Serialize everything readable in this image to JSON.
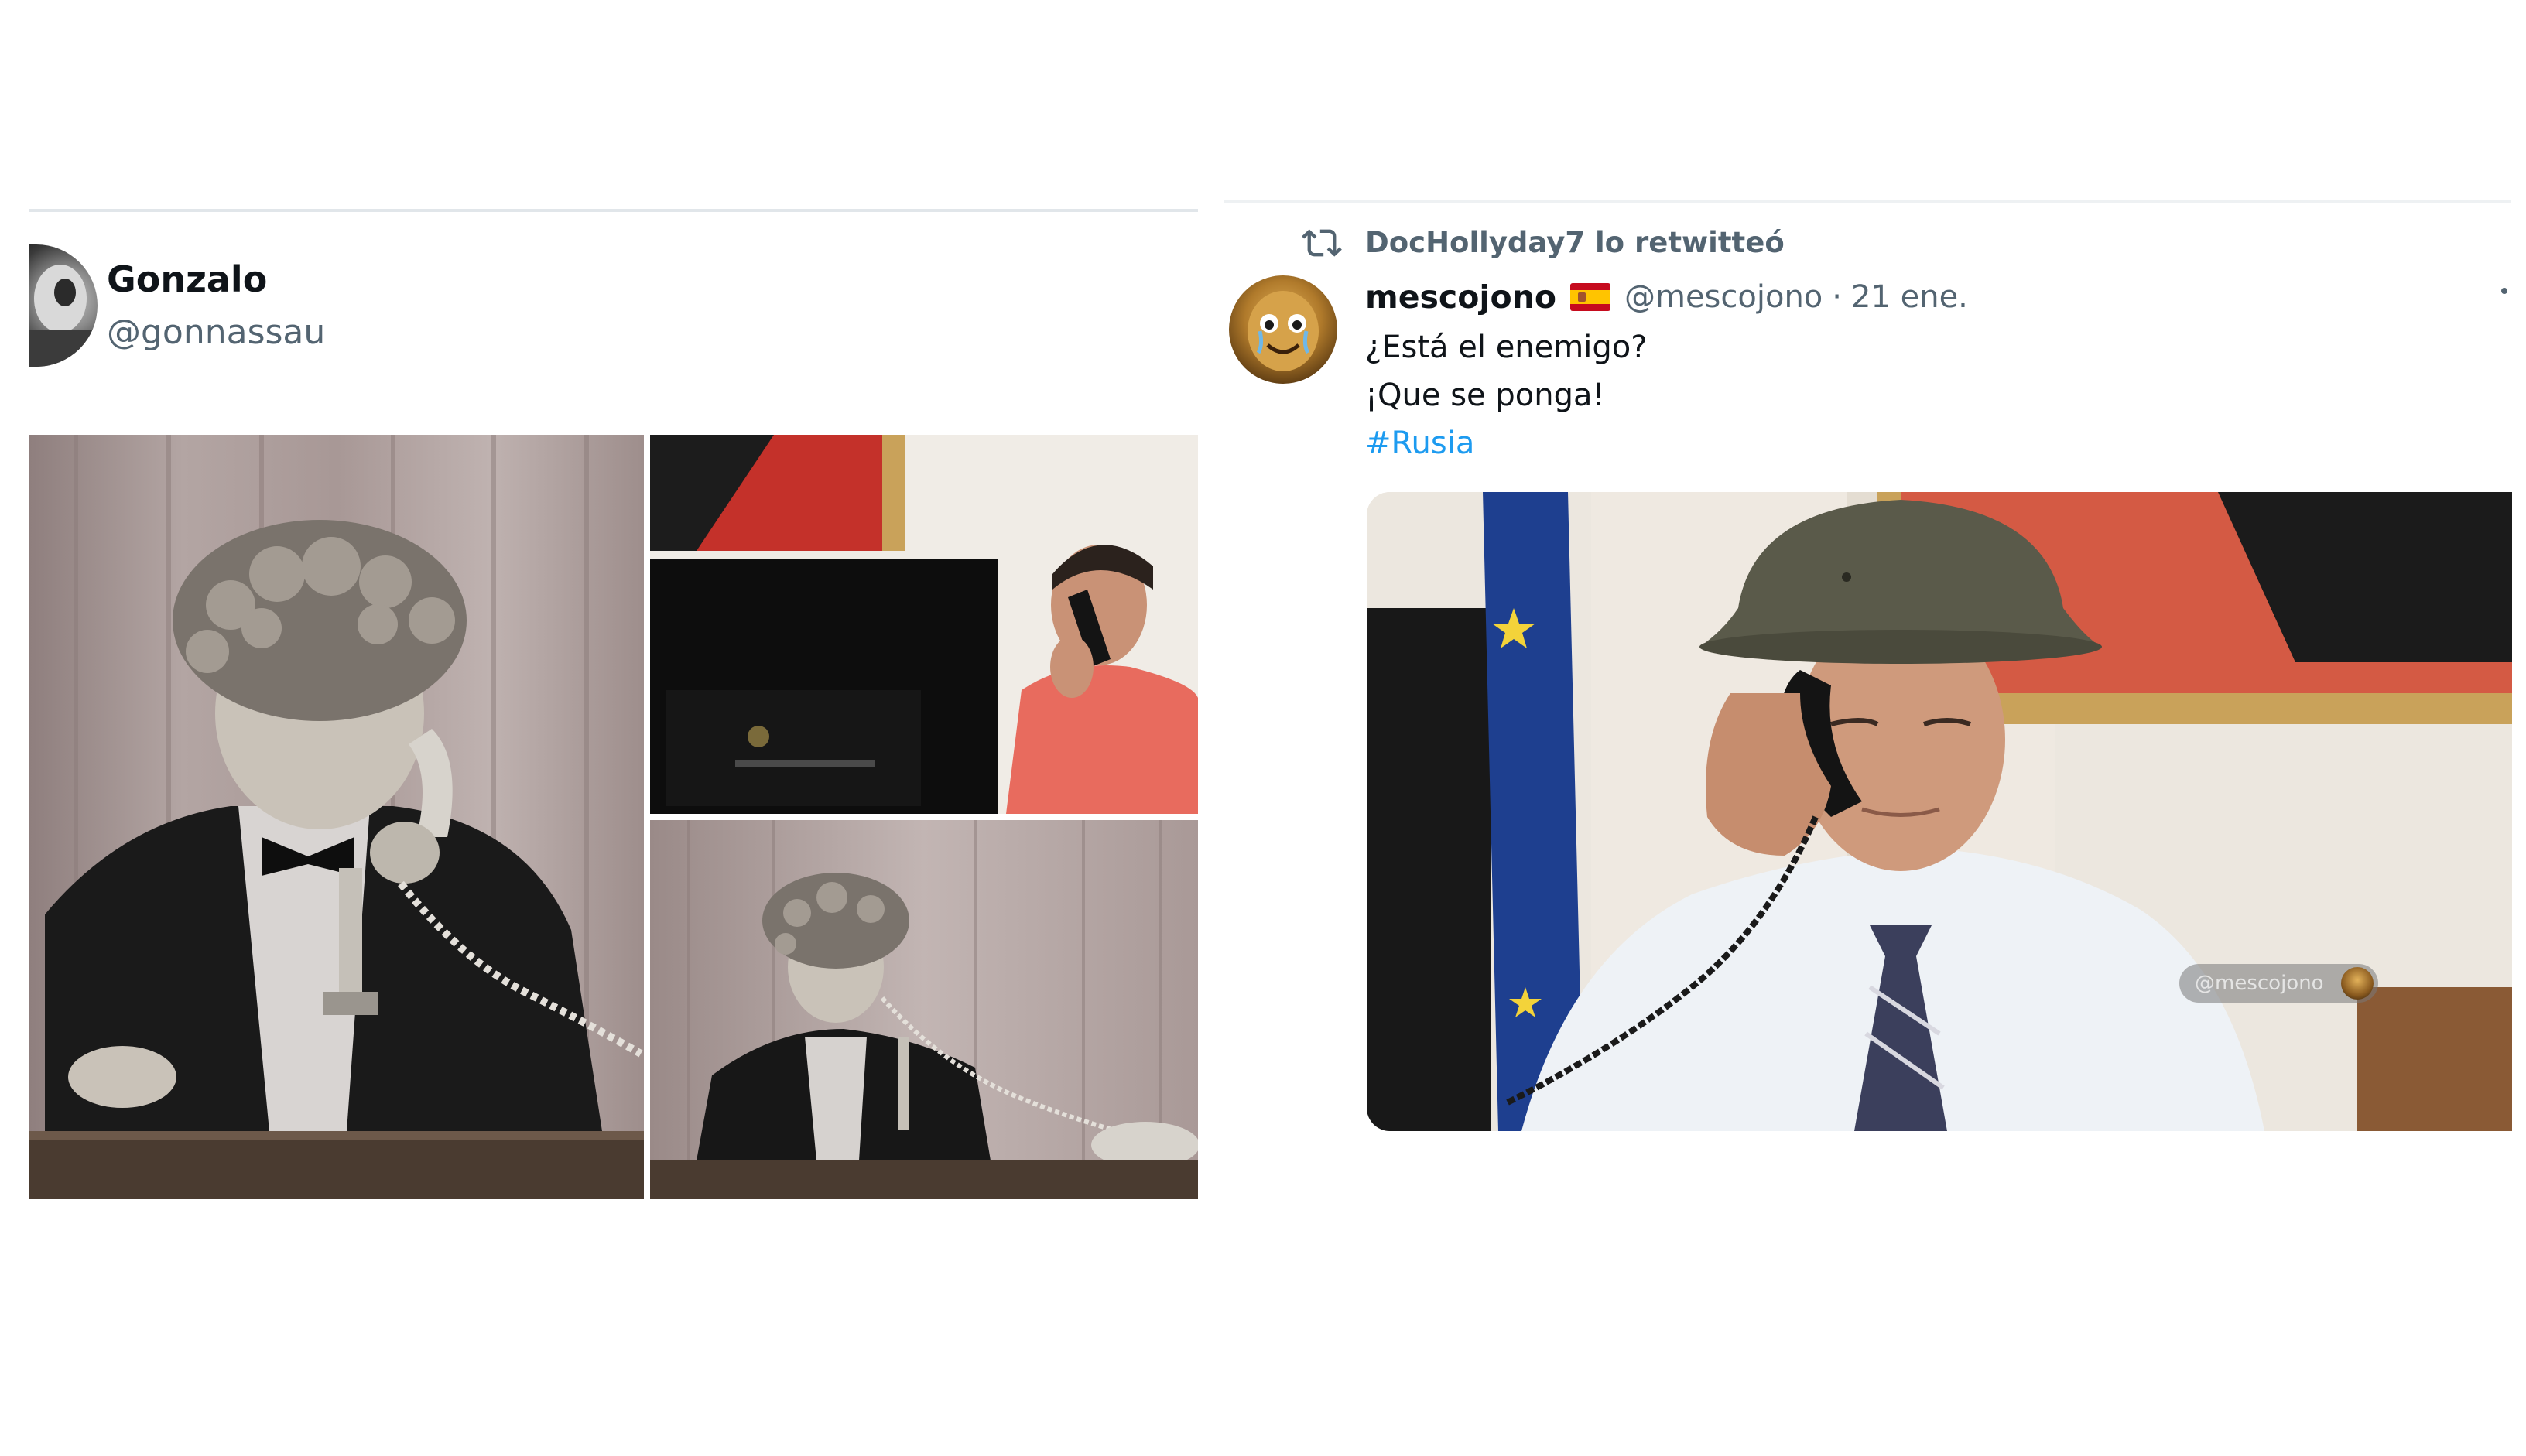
{
  "left_tweet": {
    "display_name": "Gonzalo",
    "handle": "@gonnassau",
    "avatar_icon": "profile-photo",
    "media": [
      {
        "name": "man-with-curly-wig-on-phone"
      },
      {
        "name": "man-in-red-shirt-on-phone-at-desk"
      },
      {
        "name": "man-with-curly-wig-on-phone-wide"
      }
    ]
  },
  "right_tweet": {
    "retweet_label": "DocHollyday7 lo retwitteó",
    "retweet_icon": "retweet-icon",
    "author_name": "mescojono",
    "author_flag": "spain-flag-icon",
    "author_handle": "@mescojono",
    "separator": "·",
    "date": "21 ene.",
    "text_line1": "¿Está el enemigo?",
    "text_line2": "¡Que se ponga!",
    "hashtag": "#Rusia",
    "media": {
      "name": "man-with-helmet-on-phone",
      "watermark": "@mescojono"
    }
  },
  "colors": {
    "text_primary": "#0f1419",
    "text_secondary": "#536471",
    "link": "#1d9bf0",
    "divider": "#e1e6ea"
  }
}
